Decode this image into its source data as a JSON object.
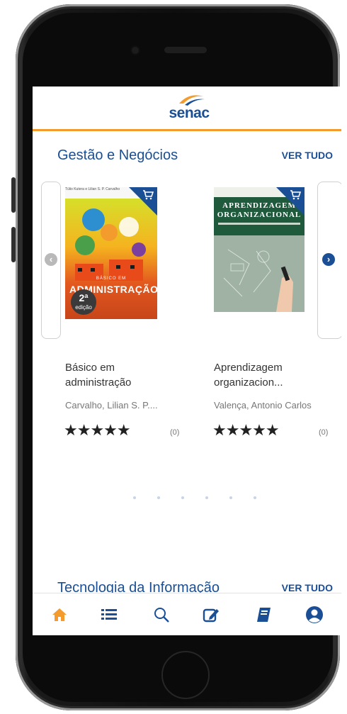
{
  "app": {
    "logo_text": "senac"
  },
  "section1": {
    "title": "Gestão e Negócios",
    "see_all": "VER TUDO"
  },
  "books": [
    {
      "title_line1": "Básico em",
      "title_line2": "administração",
      "author": "Carvalho, Lilian S. P....",
      "rating_stars": "★★★★★",
      "review_count": "(0)",
      "cover": {
        "authors": "Túlio Kutera e Lilian S. P. Carvalho",
        "small_text": "BÁSICO EM",
        "big_text": "ADMINISTRAÇÃO",
        "edition_number": "2ª",
        "edition_label": "edição"
      }
    },
    {
      "title_line1": "Aprendizagem",
      "title_line2": "organizacion...",
      "author": "Valença, Antonio Carlos",
      "rating_stars": "★★★★★",
      "review_count": "(0)",
      "cover": {
        "title_line1": "APRENDIZAGEM",
        "title_line2": "ORGANIZACIONAL"
      }
    }
  ],
  "pagination": {
    "count": 6,
    "active_index": 0
  },
  "section2": {
    "title": "Tecnologia da Informação",
    "see_all": "VER TUDO"
  },
  "nav": {
    "items": [
      {
        "icon": "home-icon",
        "active": true
      },
      {
        "icon": "list-icon",
        "active": false
      },
      {
        "icon": "search-icon",
        "active": false
      },
      {
        "icon": "edit-icon",
        "active": false
      },
      {
        "icon": "book-icon",
        "active": false
      },
      {
        "icon": "user-icon",
        "active": false
      }
    ]
  },
  "colors": {
    "brand_blue": "#1a4f96",
    "accent_orange": "#f39c2d",
    "text_dark": "#333333",
    "text_muted": "#777777"
  }
}
